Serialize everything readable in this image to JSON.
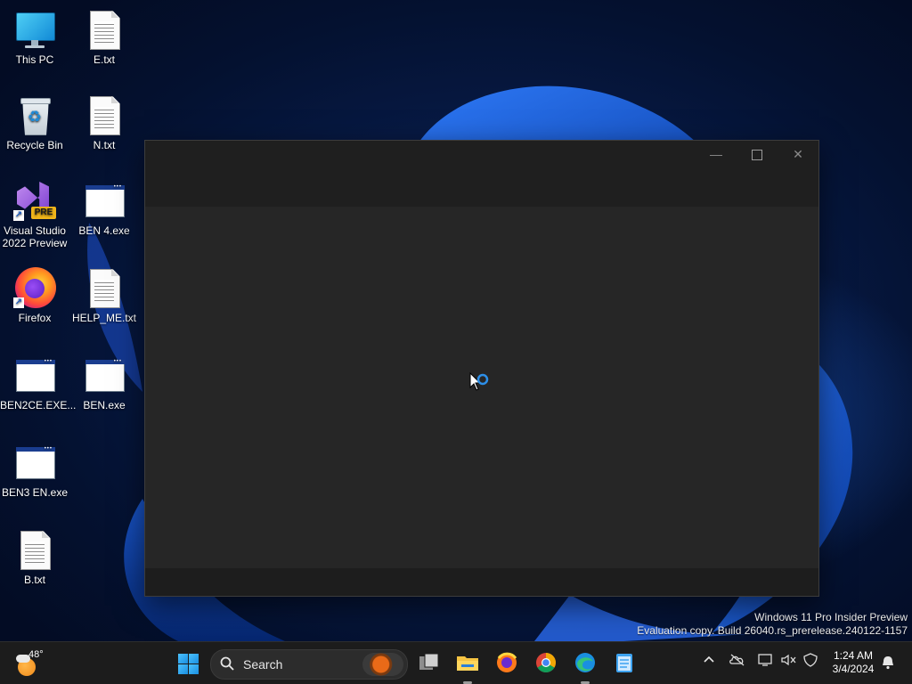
{
  "desktop": {
    "icons": [
      {
        "label": "This PC",
        "icon": "monitor-icon"
      },
      {
        "label": "E.txt",
        "icon": "text-file-icon"
      },
      {
        "label": "Recycle Bin",
        "icon": "recycle-bin-icon"
      },
      {
        "label": "N.txt",
        "icon": "text-file-icon"
      },
      {
        "label": "Visual Studio 2022 Preview",
        "icon": "visual-studio-icon",
        "badge": "PRE"
      },
      {
        "label": "BEN 4.exe",
        "icon": "exe-window-icon"
      },
      {
        "label": "Firefox",
        "icon": "firefox-icon"
      },
      {
        "label": "HELP_ME.txt",
        "icon": "text-file-icon"
      },
      {
        "label": "BEN2CE.EXE...",
        "icon": "exe-window-icon"
      },
      {
        "label": "BEN.exe",
        "icon": "exe-window-icon"
      },
      {
        "label": "BEN3 EN.exe",
        "icon": "exe-window-icon"
      },
      {
        "label": "B.txt",
        "icon": "text-file-icon"
      }
    ],
    "shortcut_arrow": "↗"
  },
  "window": {
    "controls": {
      "minimize": "—",
      "close": "✕"
    }
  },
  "watermark": {
    "line1": "Windows 11 Pro Insider Preview",
    "line2": "Evaluation copy. Build 26040.rs_prerelease.240122-1157"
  },
  "taskbar": {
    "weather": {
      "temp": "48°"
    },
    "search": {
      "label": "Search"
    },
    "tray": {
      "chevron": "^"
    },
    "clock": {
      "time": "1:24 AM",
      "date": "3/4/2024"
    }
  },
  "colors": {
    "accent": "#1a8fe0",
    "taskbar": "#1c1c1c",
    "window_bg": "#252525"
  }
}
